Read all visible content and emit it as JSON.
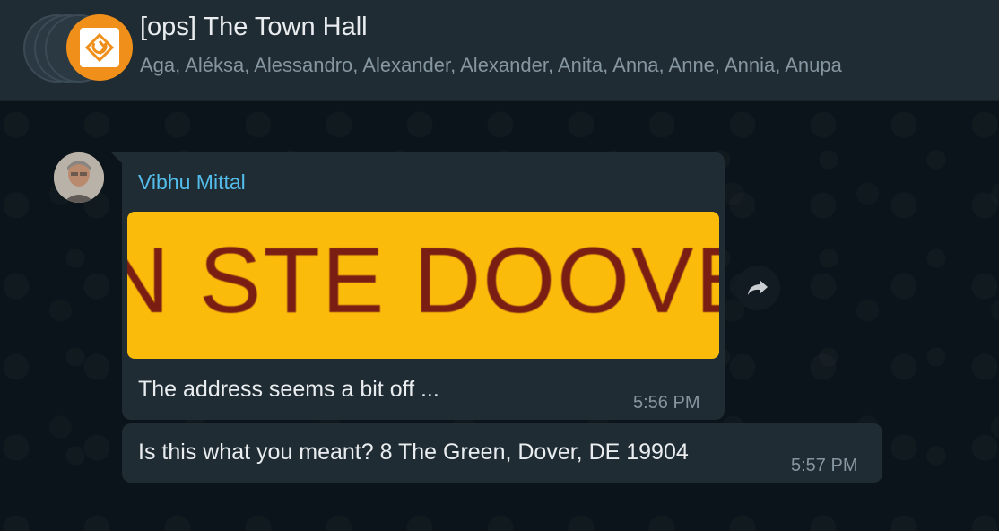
{
  "header": {
    "title": "[ops] The Town Hall",
    "members": "Aga, Aléksa, Alessandro, Alexander, Alexander, Anita, Anna, Anne, Annia, Anupa"
  },
  "messages": [
    {
      "sender": "Vibhu Mittal",
      "image_text": "N STE DOOVER",
      "text": "The address seems a bit off ...",
      "time": "5:56 PM"
    },
    {
      "text": "Is this what you meant? 8 The Green, Dover, DE 19904",
      "time": "5:57 PM"
    }
  ],
  "icons": {
    "forward": "forward-icon",
    "group_logo": "group-logo-icon"
  },
  "colors": {
    "accent_name": "#53bdeb",
    "bubble": "#202c33",
    "image_bg": "#fbbb0a"
  }
}
